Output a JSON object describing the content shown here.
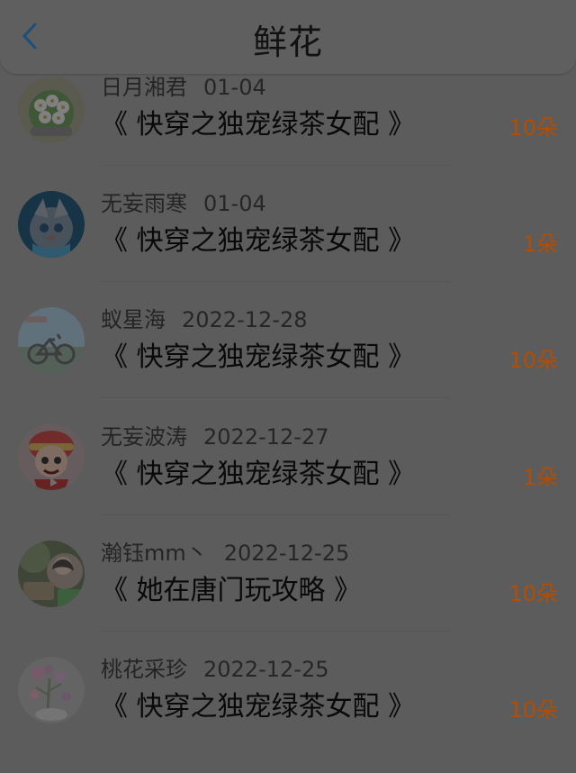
{
  "header": {
    "title": "鲜花"
  },
  "items": [
    {
      "user": "日月湘君",
      "date": "01-04",
      "book": "《 快穿之独宠绿茶女配 》",
      "flowers": "10朵"
    },
    {
      "user": "无妄雨寒",
      "date": "01-04",
      "book": "《 快穿之独宠绿茶女配 》",
      "flowers": "1朵"
    },
    {
      "user": "蚁星海",
      "date": "2022-12-28",
      "book": "《 快穿之独宠绿茶女配 》",
      "flowers": "10朵"
    },
    {
      "user": "无妄波涛",
      "date": "2022-12-27",
      "book": "《 快穿之独宠绿茶女配 》",
      "flowers": "1朵"
    },
    {
      "user": "瀚钰mm丶",
      "date": "2022-12-25",
      "book": "《 她在唐门玩攻略 》",
      "flowers": "10朵"
    },
    {
      "user": "桃花采珍",
      "date": "2022-12-25",
      "book": "《 快穿之独宠绿茶女配 》",
      "flowers": "10朵"
    }
  ]
}
